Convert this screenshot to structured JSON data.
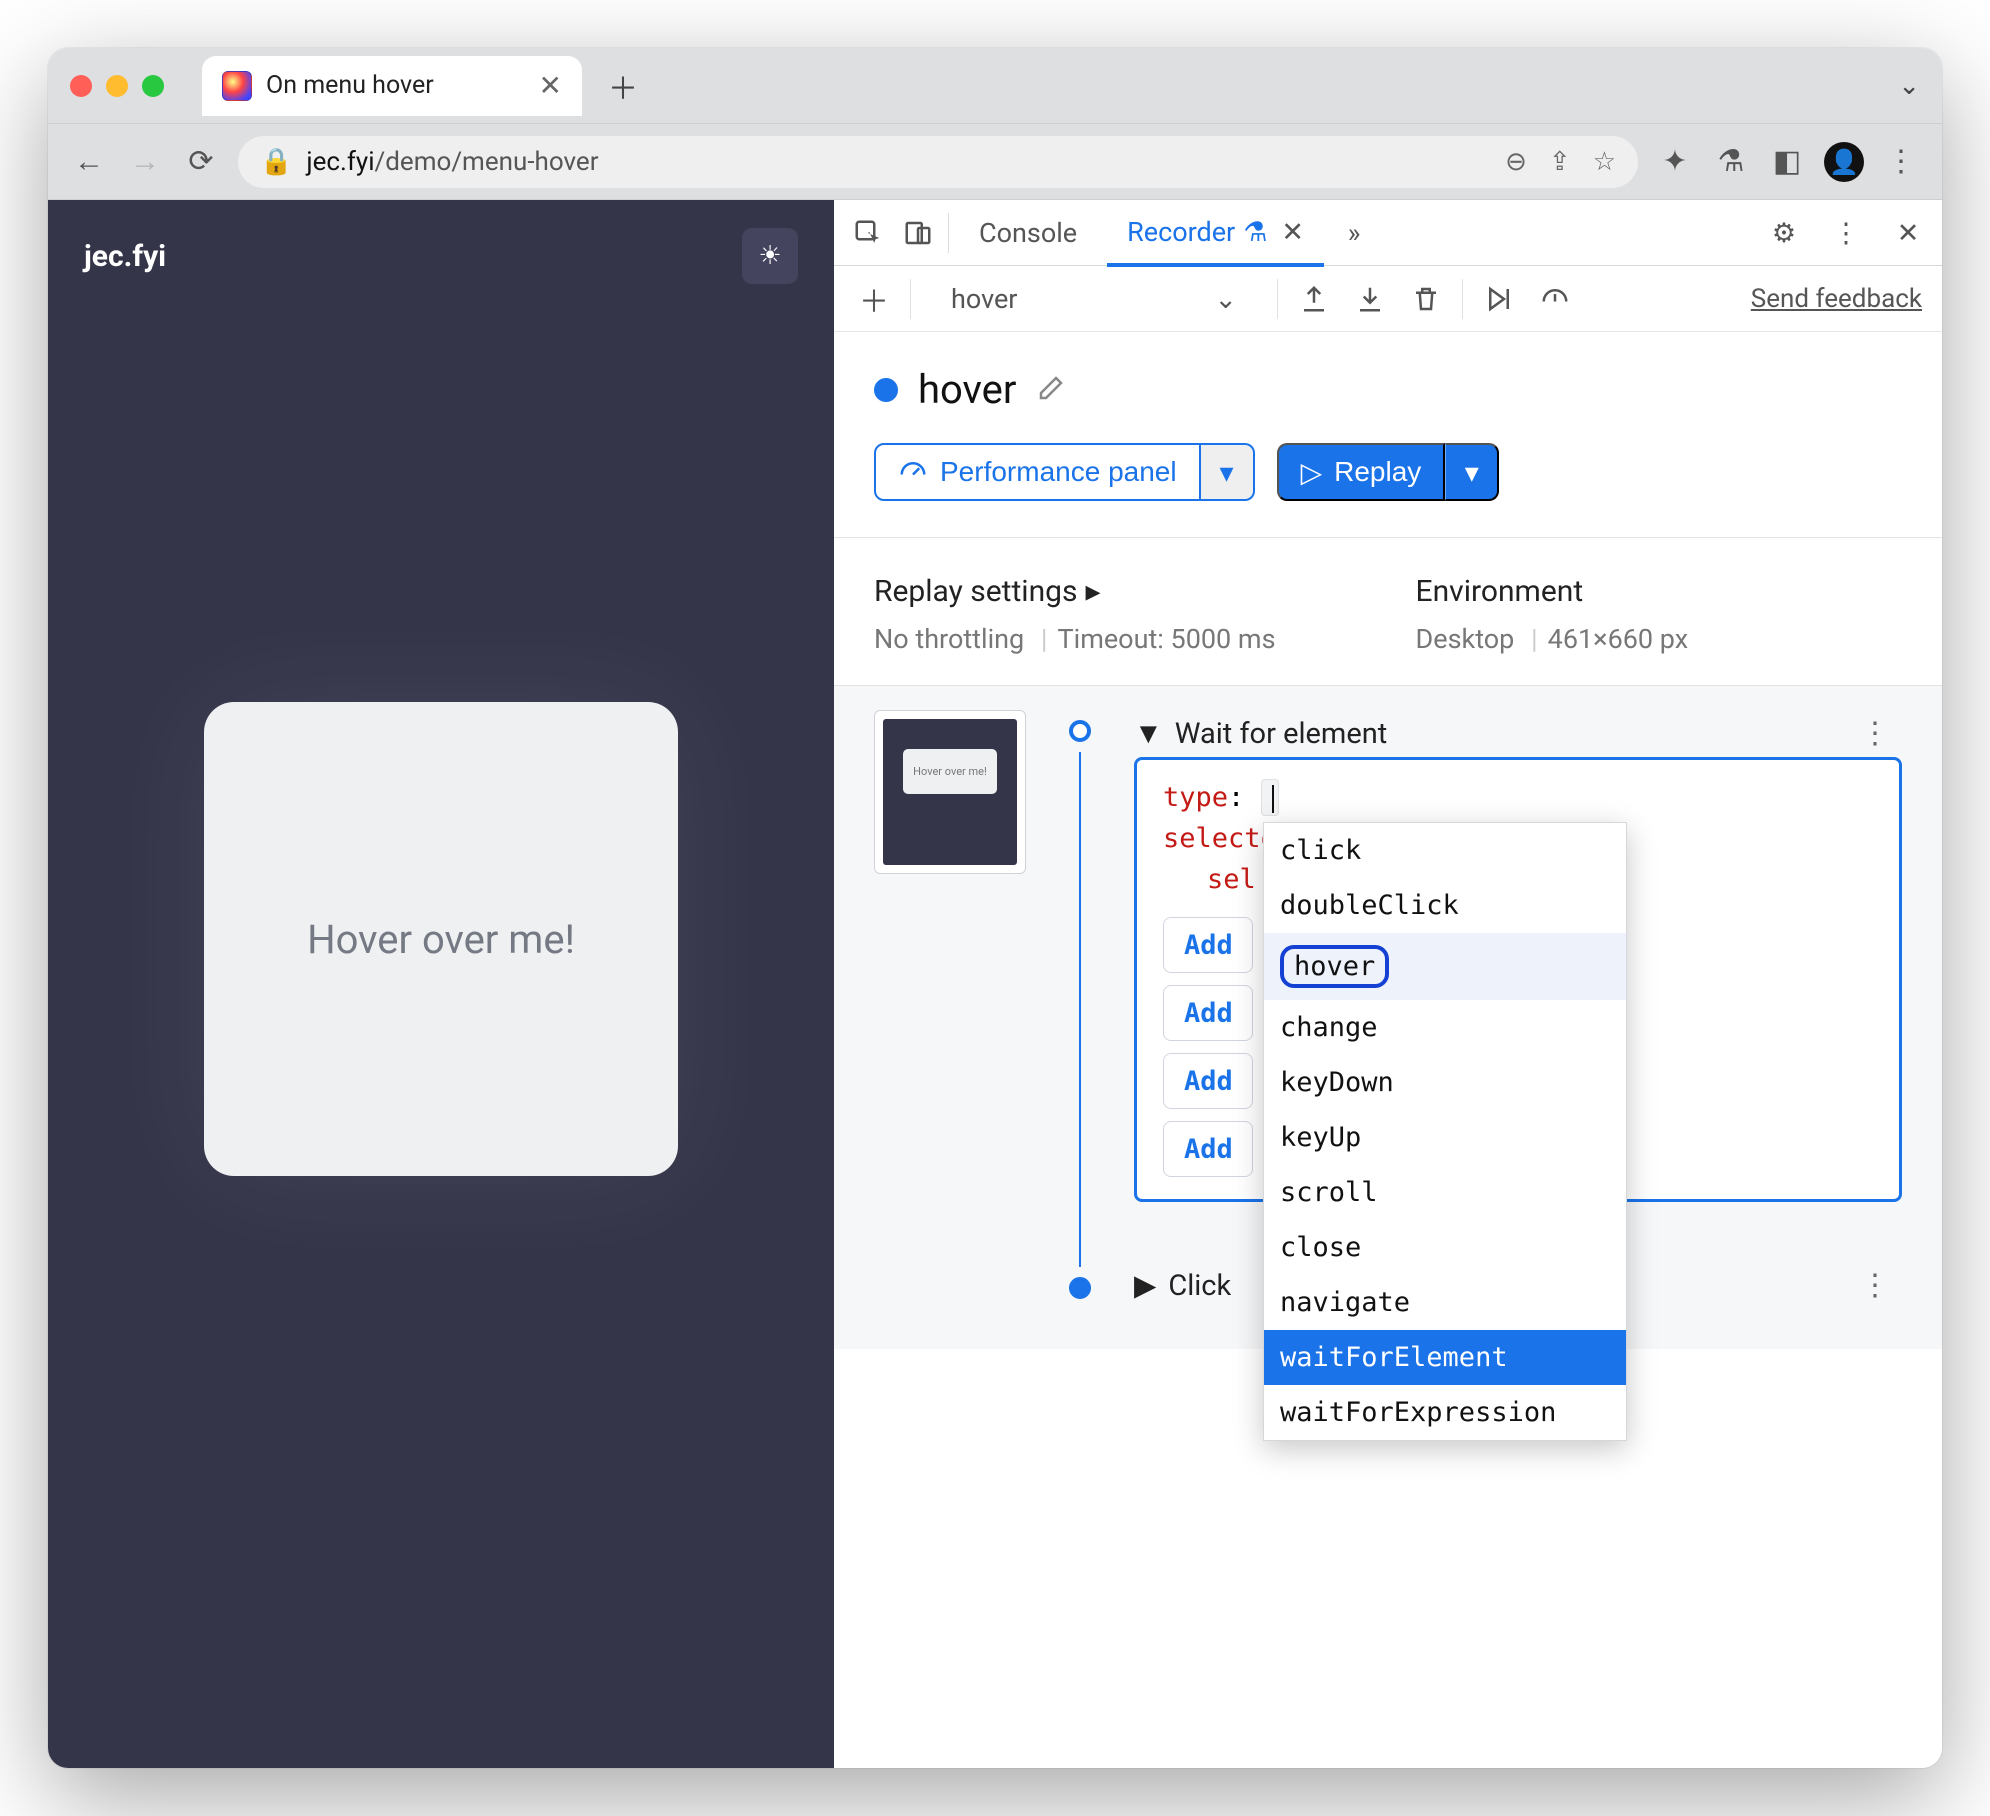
{
  "browser": {
    "tab_title": "On menu hover",
    "url_host": "jec.fyi",
    "url_path": "/demo/menu-hover"
  },
  "page": {
    "brand": "jec.fyi",
    "card_text": "Hover over me!"
  },
  "devtools": {
    "tabs": {
      "console": "Console",
      "recorder": "Recorder"
    },
    "recording_dropdown": "hover",
    "feedback": "Send feedback",
    "title": "hover",
    "perf_button": "Performance panel",
    "replay_button": "Replay",
    "replay_settings_label": "Replay settings",
    "throttling": "No throttling",
    "timeout": "Timeout: 5000 ms",
    "env_label": "Environment",
    "env_device": "Desktop",
    "env_size": "461×660 px"
  },
  "steps": {
    "wait_title": "Wait for element",
    "type_key": "type",
    "selectors_key": "selectors",
    "sel_prefix": "sel",
    "add_label": "Add",
    "click_title": "Click",
    "thumb_text": "Hover over me!"
  },
  "dropdown": {
    "options": [
      "click",
      "doubleClick",
      "hover",
      "change",
      "keyDown",
      "keyUp",
      "scroll",
      "close",
      "navigate",
      "waitForElement",
      "waitForExpression"
    ],
    "circled": "hover",
    "selected": "waitForElement"
  }
}
